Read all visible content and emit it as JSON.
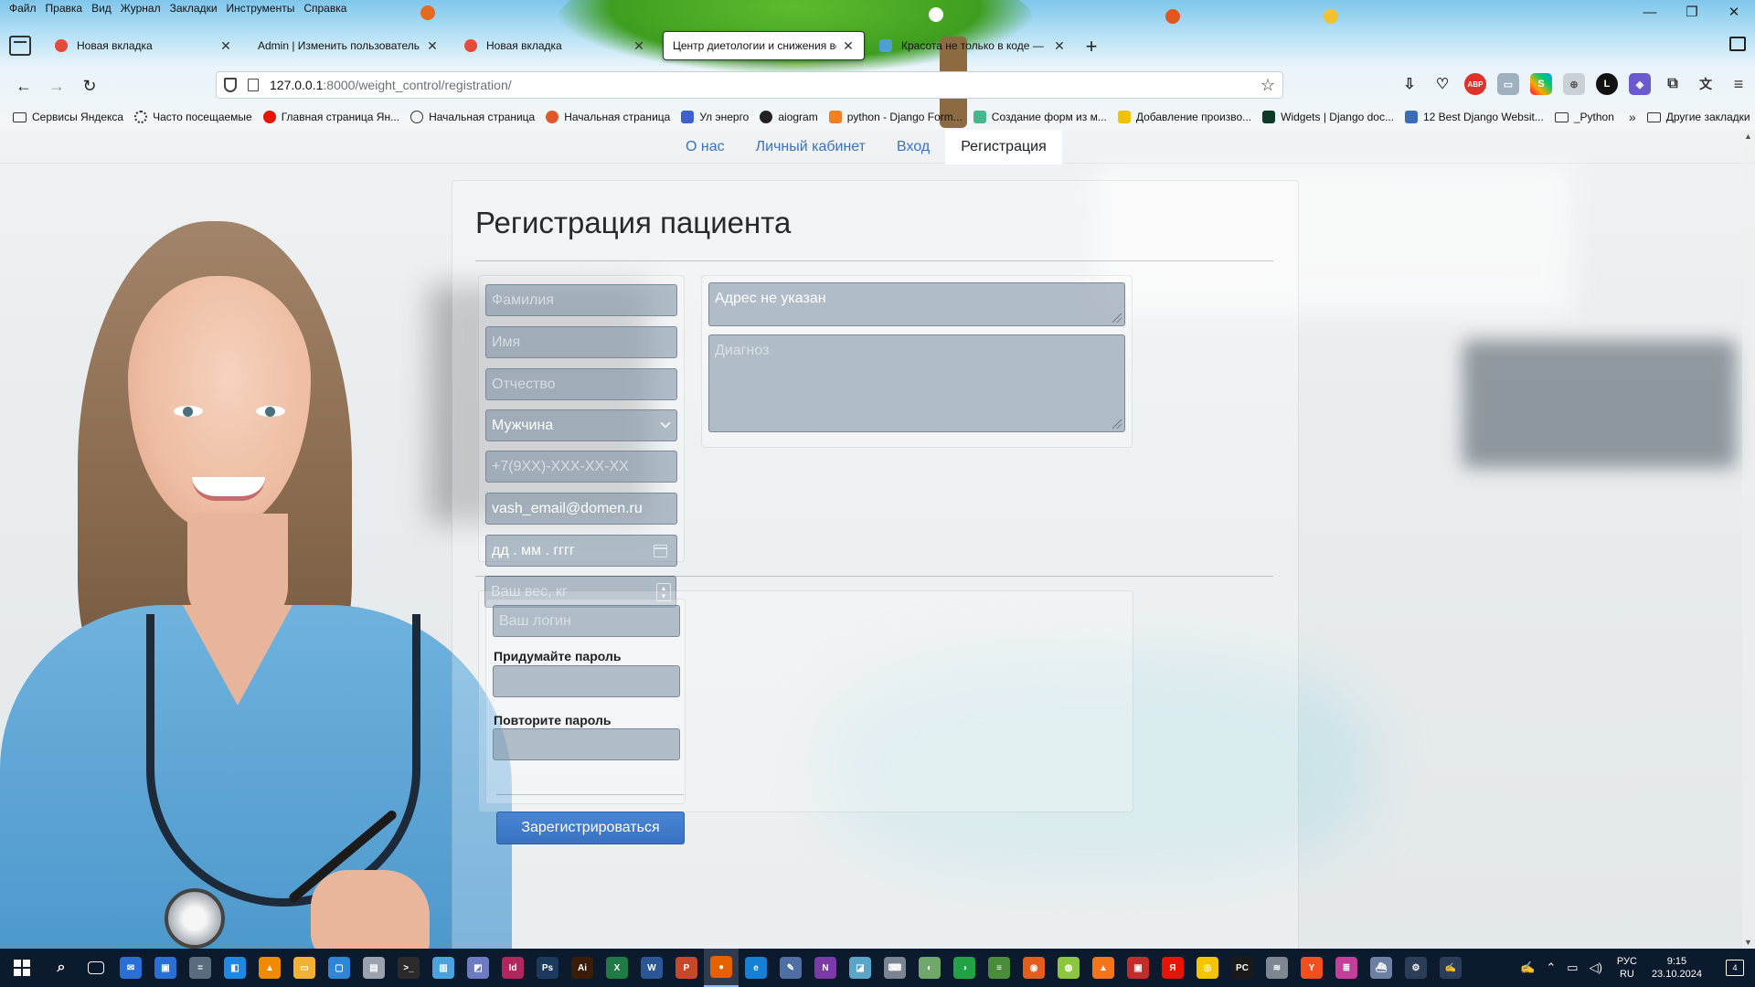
{
  "browser": {
    "menu": [
      "Файл",
      "Правка",
      "Вид",
      "Журнал",
      "Закладки",
      "Инструменты",
      "Справка"
    ],
    "tabs": [
      {
        "title": "Новая вкладка",
        "favicon_color": "#e24a3b"
      },
      {
        "title": "Admin | Изменить пользователь | Adm",
        "favicon_color": "#2d6d57"
      },
      {
        "title": "Новая вкладка",
        "favicon_color": "#e24a3b"
      },
      {
        "title": "Центр диетологии и снижения веса",
        "favicon_color": "#ffffff"
      },
      {
        "title": "Красота не только в коде —",
        "favicon_color": "#4d9ed9"
      }
    ],
    "new_tab": "+",
    "url_host": "127.0.0.1",
    "url_path": ":8000/weight_control/registration/",
    "bookmarks": [
      {
        "label": "Сервисы Яндекса",
        "icon": "folder-icon",
        "color": ""
      },
      {
        "label": "Часто посещаемые",
        "icon": "gear-icon",
        "color": "#333333"
      },
      {
        "label": "Главная страница Ян...",
        "icon": "yandex-icon",
        "color": "#e61400"
      },
      {
        "label": "Начальная страница",
        "icon": "globe-icon",
        "color": "#333333"
      },
      {
        "label": "Начальная страница",
        "icon": "firefox-icon",
        "color": "#e0592a"
      },
      {
        "label": "Ул энерго",
        "icon": "ul-energo-icon",
        "color": "#3f61c9"
      },
      {
        "label": "aiogram",
        "icon": "aiogram-icon",
        "color": "#222222"
      },
      {
        "label": "python - Django Form...",
        "icon": "stackoverflow-icon",
        "color": "#f48024"
      },
      {
        "label": "Создание форм из м...",
        "icon": "django-icon",
        "color": "#44b78b"
      },
      {
        "label": "Добавление произво...",
        "icon": "arrow-icon",
        "color": "#f2c200"
      },
      {
        "label": "Widgets | Django doc...",
        "icon": "django-docs-icon",
        "color": "#0c3c26"
      },
      {
        "label": "12 Best Django Websit...",
        "icon": "site-icon",
        "color": "#3b6cb8"
      },
      {
        "label": "_Python",
        "icon": "folder-icon",
        "color": ""
      }
    ],
    "bookmarks_overflow": "»",
    "other_bookmarks": "Другие закладки"
  },
  "site": {
    "nav": [
      {
        "label": "О нас",
        "active": false
      },
      {
        "label": "Личный кабинет",
        "active": false
      },
      {
        "label": "Вход",
        "active": false
      },
      {
        "label": "Регистрация",
        "active": true
      }
    ],
    "title": "Регистрация пациента",
    "form": {
      "last_name_placeholder": "Фамилия",
      "first_name_placeholder": "Имя",
      "patronymic_placeholder": "Отчество",
      "gender_value": "Мужчина",
      "phone_placeholder": "+7(9XX)-XXX-XX-XX",
      "email_value": "vash_email@domen.ru",
      "birthdate_placeholder": "дд . мм . гггг",
      "weight_placeholder": "Ваш вес, кг",
      "address_value": "Адрес не указан",
      "diagnosis_placeholder": "Диагноз",
      "login_placeholder": "Ваш логин",
      "password_label": "Придумайте пароль",
      "password_confirm_label": "Повторите пароль",
      "submit_label": "Зарегистрироваться"
    }
  },
  "taskbar": {
    "lang_top": "РУС",
    "lang_bottom": "RU",
    "time": "9:15",
    "date": "23.10.2024",
    "notification_count": "4",
    "apps": [
      {
        "name": "mail",
        "color": "#2a6fd6",
        "label": "✉"
      },
      {
        "name": "store",
        "color": "#2a6fd6",
        "label": "▣"
      },
      {
        "name": "calculator",
        "color": "#5a6b7d",
        "label": "="
      },
      {
        "name": "app-blue",
        "color": "#1e88e5",
        "label": "◧"
      },
      {
        "name": "vlc",
        "color": "#f08a00",
        "label": "▲"
      },
      {
        "name": "explorer",
        "color": "#f2b134",
        "label": "▭"
      },
      {
        "name": "app-window",
        "color": "#2f86d6",
        "label": "▢"
      },
      {
        "name": "app-print",
        "color": "#9aa3ad",
        "label": "▤"
      },
      {
        "name": "terminal",
        "color": "#2b2b2b",
        "label": ">_"
      },
      {
        "name": "app-sheet",
        "color": "#4aa3df",
        "label": "▥"
      },
      {
        "name": "app-duo",
        "color": "#6d7cc2",
        "label": "◩"
      },
      {
        "name": "indesign",
        "color": "#b4245d",
        "label": "Id"
      },
      {
        "name": "photoshop",
        "color": "#1c3a5e",
        "label": "Ps"
      },
      {
        "name": "illustrator",
        "color": "#3a1d06",
        "label": "Ai"
      },
      {
        "name": "excel",
        "color": "#1f7a45",
        "label": "X"
      },
      {
        "name": "word",
        "color": "#2b5797",
        "label": "W"
      },
      {
        "name": "powerpoint",
        "color": "#c8472b",
        "label": "P"
      },
      {
        "name": "firefox",
        "color": "#e66000",
        "label": "●"
      },
      {
        "name": "edge",
        "color": "#1581d6",
        "label": "e"
      },
      {
        "name": "notepad",
        "color": "#4f6ea3",
        "label": "✎"
      },
      {
        "name": "onenote",
        "color": "#7b3aa8",
        "label": "N"
      },
      {
        "name": "app-paper",
        "color": "#5aa6c8",
        "label": "◪"
      },
      {
        "name": "keyboard",
        "color": "#7b8590",
        "label": "⌨"
      },
      {
        "name": "app-green",
        "color": "#6fa86a",
        "label": "◐"
      },
      {
        "name": "app-lime",
        "color": "#21a245",
        "label": "◑"
      },
      {
        "name": "app-books",
        "color": "#4a8c3a",
        "label": "≡"
      },
      {
        "name": "app-orange",
        "color": "#e45d1c",
        "label": "◉"
      },
      {
        "name": "app-ball",
        "color": "#8cc63f",
        "label": "◍"
      },
      {
        "name": "app-fire",
        "color": "#f1761a",
        "label": "▲"
      },
      {
        "name": "app-red",
        "color": "#c42b2b",
        "label": "▣"
      },
      {
        "name": "yandex",
        "color": "#e61400",
        "label": "Я"
      },
      {
        "name": "beeline",
        "color": "#f5c400",
        "label": "◎"
      },
      {
        "name": "pycharm",
        "color": "#1a1a1a",
        "label": "PC"
      },
      {
        "name": "database",
        "color": "#7d8792",
        "label": "≋"
      },
      {
        "name": "yandex-browser",
        "color": "#f24e1e",
        "label": "Y"
      },
      {
        "name": "app-stripes",
        "color": "#c43e9a",
        "label": "≣"
      },
      {
        "name": "app-ship",
        "color": "#6d7fa2",
        "label": "⛴"
      },
      {
        "name": "settings",
        "color": "#2c3e57",
        "label": "⚙"
      },
      {
        "name": "app-pen",
        "color": "#2c3e57",
        "label": "✍"
      }
    ]
  }
}
